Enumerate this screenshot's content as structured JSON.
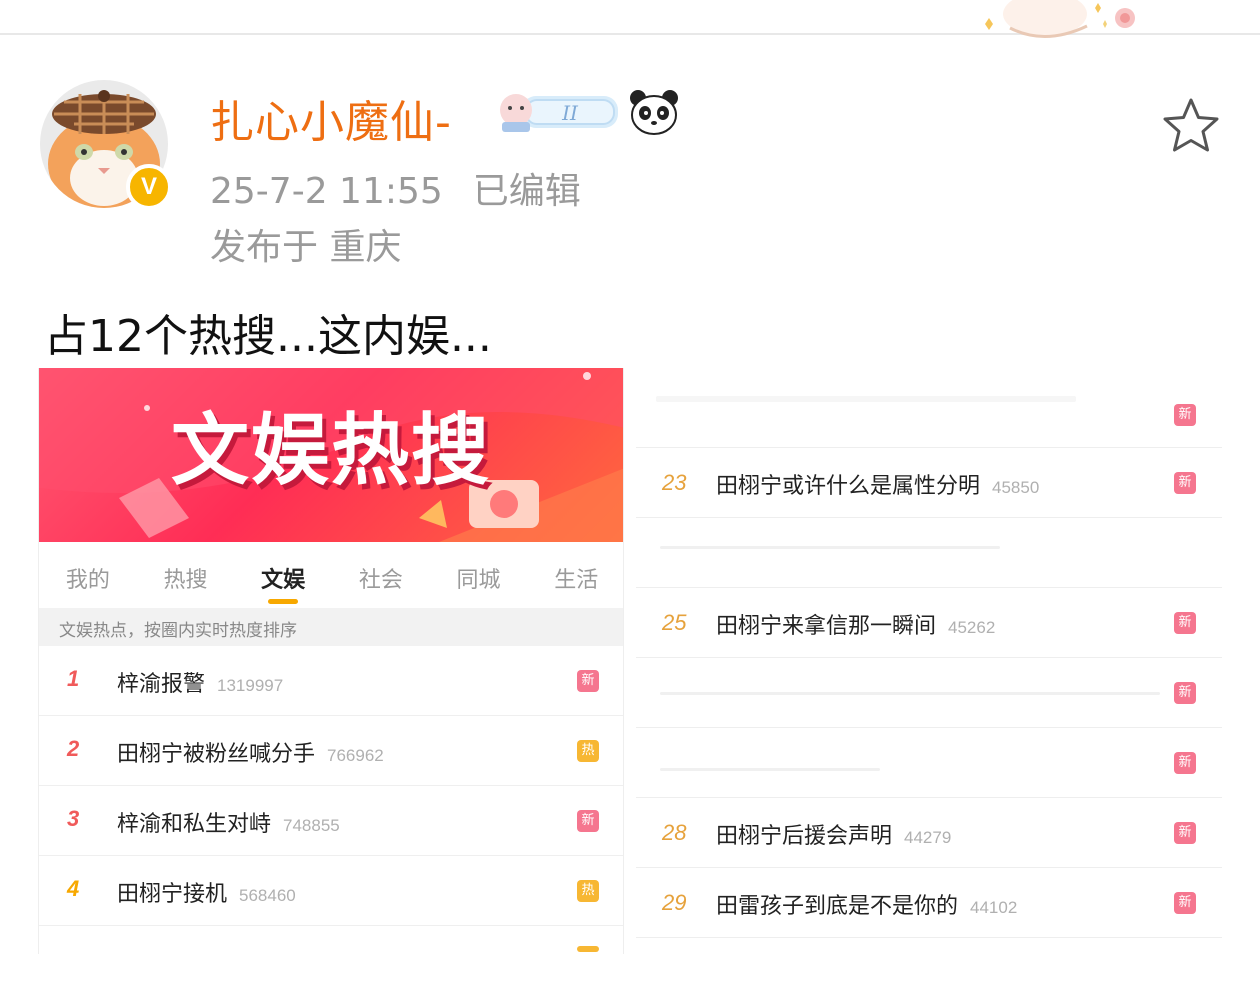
{
  "post": {
    "username": "扎心小魔仙-",
    "timestamp": "25-7-2 11:55",
    "edited": "已编辑",
    "location": "发布于 重庆",
    "text": "占12个热搜...这内娱..."
  },
  "icons": {
    "verified": "verified-v-badge",
    "member_badge": "gemini-member-badge",
    "emoji": "panda-icon",
    "favorite": "star-outline-icon"
  },
  "colors": {
    "username": "#ee6e12",
    "verified_badge": "#f7b500",
    "banner": "#ff2d55",
    "tag_new": "#f5768f",
    "tag_hot": "#f7b733"
  },
  "left_screenshot": {
    "banner_title": "文娱热搜",
    "tabs": [
      {
        "label": "我的",
        "active": false
      },
      {
        "label": "热搜",
        "active": false
      },
      {
        "label": "文娱",
        "active": true
      },
      {
        "label": "社会",
        "active": false
      },
      {
        "label": "同城",
        "active": false
      },
      {
        "label": "生活",
        "active": false
      }
    ],
    "hint": "文娱热点，按圈内实时热度排序",
    "rows": [
      {
        "rank": "1",
        "topic": "梓渝报警",
        "heat": "1319997",
        "tag": "新",
        "tag_type": "new"
      },
      {
        "rank": "2",
        "topic": "田栩宁被粉丝喊分手",
        "heat": "766962",
        "tag": "热",
        "tag_type": "hot"
      },
      {
        "rank": "3",
        "topic": "梓渝和私生对峙",
        "heat": "748855",
        "tag": "新",
        "tag_type": "new"
      },
      {
        "rank": "4",
        "topic": "田栩宁接机",
        "heat": "568460",
        "tag": "热",
        "tag_type": "hot"
      }
    ]
  },
  "right_screenshot": {
    "rows": [
      {
        "rank": "",
        "topic": "",
        "heat": "",
        "tag": "新"
      },
      {
        "rank": "23",
        "topic": "田栩宁或许什么是属性分明",
        "heat": "45850",
        "tag": "新"
      },
      {
        "rank": "",
        "topic": "",
        "heat": "",
        "tag": ""
      },
      {
        "rank": "25",
        "topic": "田栩宁来拿信那一瞬间",
        "heat": "45262",
        "tag": "新"
      },
      {
        "rank": "",
        "topic": "",
        "heat": "",
        "tag": "新"
      },
      {
        "rank": "",
        "topic": "",
        "heat": "",
        "tag": "新"
      },
      {
        "rank": "28",
        "topic": "田栩宁后援会声明",
        "heat": "44279",
        "tag": "新"
      },
      {
        "rank": "29",
        "topic": "田雷孩子到底是不是你的",
        "heat": "44102",
        "tag": "新"
      }
    ]
  }
}
